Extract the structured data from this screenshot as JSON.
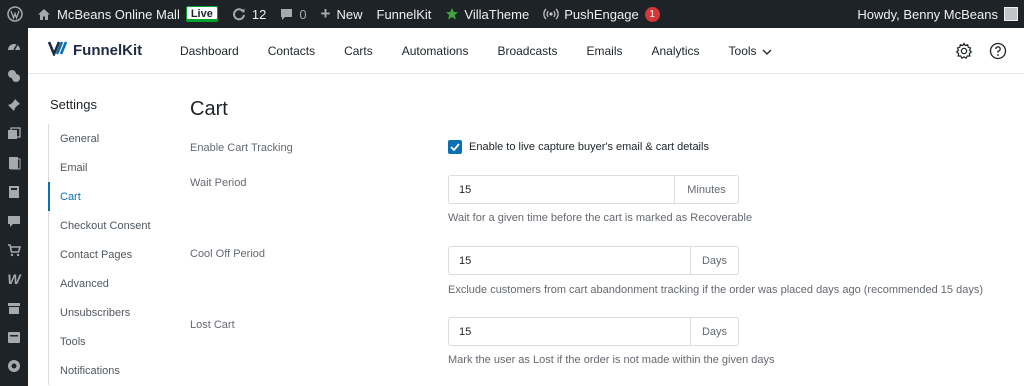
{
  "admin_bar": {
    "site_name": "McBeans Online Mall",
    "live_badge": "Live",
    "updates_count": "12",
    "comments_count": "0",
    "new_label": "New",
    "funnelkit_label": "FunnelKit",
    "villatheme_label": "VillaTheme",
    "pushengage_label": "PushEngage",
    "pushengage_badge": "1",
    "greeting": "Howdy, Benny McBeans"
  },
  "header": {
    "logo_text": "FunnelKit",
    "nav": [
      "Dashboard",
      "Contacts",
      "Carts",
      "Automations",
      "Broadcasts",
      "Emails",
      "Analytics",
      "Tools"
    ]
  },
  "sidebar": {
    "title": "Settings",
    "items": [
      "General",
      "Email",
      "Cart",
      "Checkout Consent",
      "Contact Pages",
      "Advanced",
      "Unsubscribers",
      "Tools",
      "Notifications"
    ],
    "active": "Cart"
  },
  "main": {
    "title": "Cart",
    "enable_tracking": {
      "label": "Enable Cart Tracking",
      "checkbox_label": "Enable to live capture buyer's email & cart details",
      "checked": true
    },
    "wait_period": {
      "label": "Wait Period",
      "value": "15",
      "unit": "Minutes",
      "help": "Wait for a given time before the cart is marked as Recoverable"
    },
    "cool_off_period": {
      "label": "Cool Off Period",
      "value": "15",
      "unit": "Days",
      "help": "Exclude customers from cart abandonment tracking if the order was placed days ago (recommended 15 days)"
    },
    "lost_cart": {
      "label": "Lost Cart",
      "value": "15",
      "unit": "Days",
      "help": "Mark the user as Lost if the order is not made within the given days"
    }
  },
  "colors": {
    "admin_bar_bg": "#1d2327",
    "accent": "#0b70b3",
    "live_badge_border": "#00a32a",
    "notification_badge": "#d63638"
  }
}
